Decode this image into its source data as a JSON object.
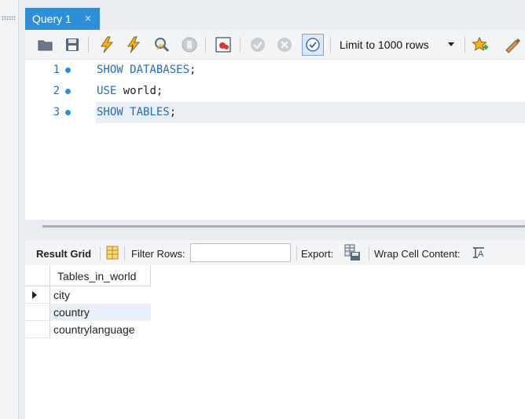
{
  "tab": {
    "label": "Query 1",
    "close_glyph": "×"
  },
  "toolbar": {
    "icons": [
      "open-folder-icon",
      "save-icon",
      "execute-icon",
      "execute-current-icon",
      "explain-icon",
      "stop-icon",
      "toggle-results-icon",
      "commit-icon",
      "rollback-icon",
      "autocommit-icon",
      "add-snippet-icon",
      "beautify-icon"
    ],
    "limit_label": "Limit to 1000 rows"
  },
  "editor": {
    "lines": [
      {
        "number": "1",
        "keyword": "SHOW DATABASES",
        "ident": "",
        "end": ";"
      },
      {
        "number": "2",
        "keyword": "USE",
        "ident": " world",
        "end": ";"
      },
      {
        "number": "3",
        "keyword": "SHOW TABLES",
        "ident": "",
        "end": ";"
      }
    ]
  },
  "results_toolbar": {
    "result_grid": "Result Grid",
    "filter_rows": "Filter Rows:",
    "filter_value": "",
    "export": "Export:",
    "wrap": "Wrap Cell Content:"
  },
  "grid": {
    "column": "Tables_in_world",
    "rows": [
      "city",
      "country",
      "countrylanguage"
    ]
  },
  "colors": {
    "accent": "#2e8fd8",
    "keyword": "#1f6fbf",
    "line_number": "#2f6fb8"
  }
}
